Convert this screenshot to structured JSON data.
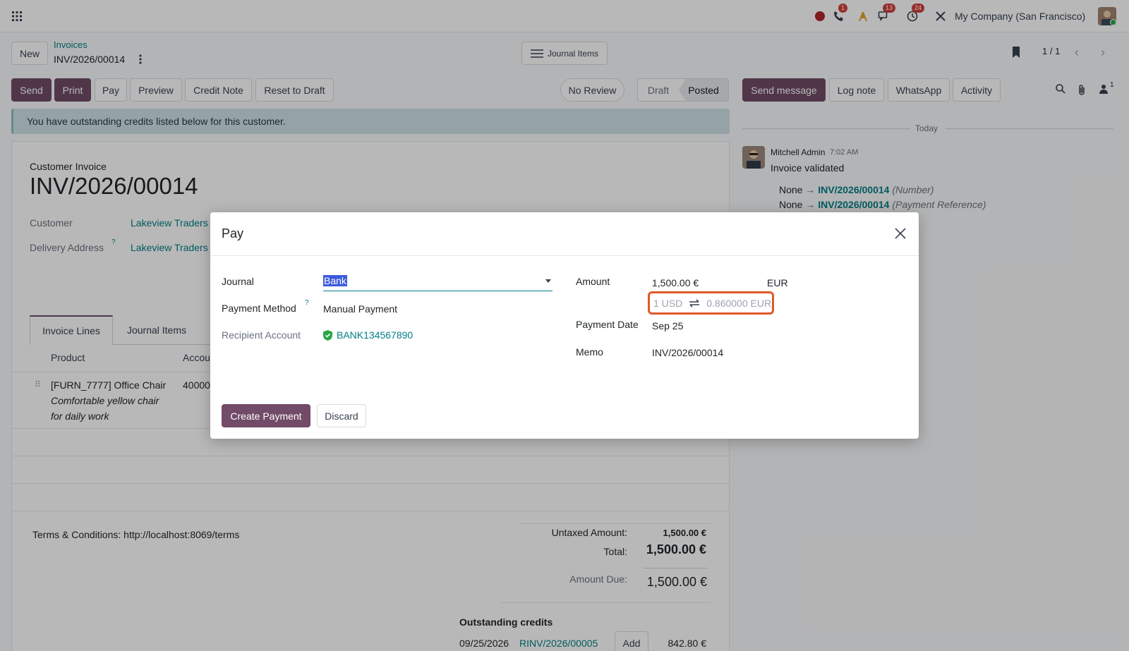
{
  "navbar": {
    "company": "My Company (San Francisco)",
    "phone_badge": "1",
    "chat_badge": "13",
    "activity_badge": "24"
  },
  "breadcrumb": {
    "new_label": "New",
    "parent": "Invoices",
    "current": "INV/2026/00014",
    "journal_items_button": "Journal Items",
    "pager": "1 / 1"
  },
  "toolbar": {
    "send": "Send",
    "print": "Print",
    "pay": "Pay",
    "preview": "Preview",
    "credit_note": "Credit Note",
    "reset": "Reset to Draft",
    "no_review": "No Review",
    "status_draft": "Draft",
    "status_posted": "Posted"
  },
  "chatter": {
    "send_message": "Send message",
    "log_note": "Log note",
    "whatsapp": "WhatsApp",
    "activity": "Activity",
    "followers_count": "1",
    "today": "Today",
    "author": "Mitchell Admin",
    "time": "7:02 AM",
    "message": "Invoice validated",
    "changes": [
      {
        "from": "None",
        "to": "INV/2026/00014",
        "field": "(Number)"
      },
      {
        "from": "None",
        "to": "INV/2026/00014",
        "field": "(Payment Reference)"
      }
    ]
  },
  "alert": "You have outstanding credits listed below for this customer.",
  "invoice": {
    "type_label": "Customer Invoice",
    "number": "INV/2026/00014",
    "customer_label": "Customer",
    "customer": "Lakeview Traders",
    "delivery_label": "Delivery Address",
    "delivery": "Lakeview Traders",
    "tabs": [
      "Invoice Lines",
      "Journal Items"
    ],
    "columns": {
      "product": "Product",
      "account": "Accou"
    },
    "line": {
      "product": "[FURN_7777] Office Chair",
      "description_1": "Comfortable yellow chair",
      "description_2": "for daily work",
      "account": "40000"
    },
    "terms": "Terms & Conditions: http://localhost:8069/terms",
    "untaxed_label": "Untaxed Amount:",
    "untaxed": "1,500.00 €",
    "total_label": "Total:",
    "total": "1,500.00 €",
    "due_label": "Amount Due:",
    "due": "1,500.00 €",
    "outstanding_title": "Outstanding credits",
    "credit": {
      "date": "09/25/2026",
      "ref": "RINV/2026/00005",
      "add": "Add",
      "amount": "842.80 €"
    }
  },
  "dialog": {
    "title": "Pay",
    "journal_label": "Journal",
    "journal_value": "Bank",
    "method_label": "Payment Method",
    "method_value": "Manual Payment",
    "recipient_label": "Recipient Account",
    "recipient_value": "BANK134567890",
    "amount_label": "Amount",
    "amount_value": "1,500.00 €",
    "currency": "EUR",
    "rate_from": "1 USD",
    "rate_to": "0.860000 EUR",
    "date_label": "Payment Date",
    "date_value": "Sep 25",
    "memo_label": "Memo",
    "memo_value": "INV/2026/00014",
    "create_button": "Create Payment",
    "discard_button": "Discard"
  },
  "colors": {
    "primary": "#714b67",
    "link": "#017e84",
    "highlight": "#e05a2b"
  }
}
